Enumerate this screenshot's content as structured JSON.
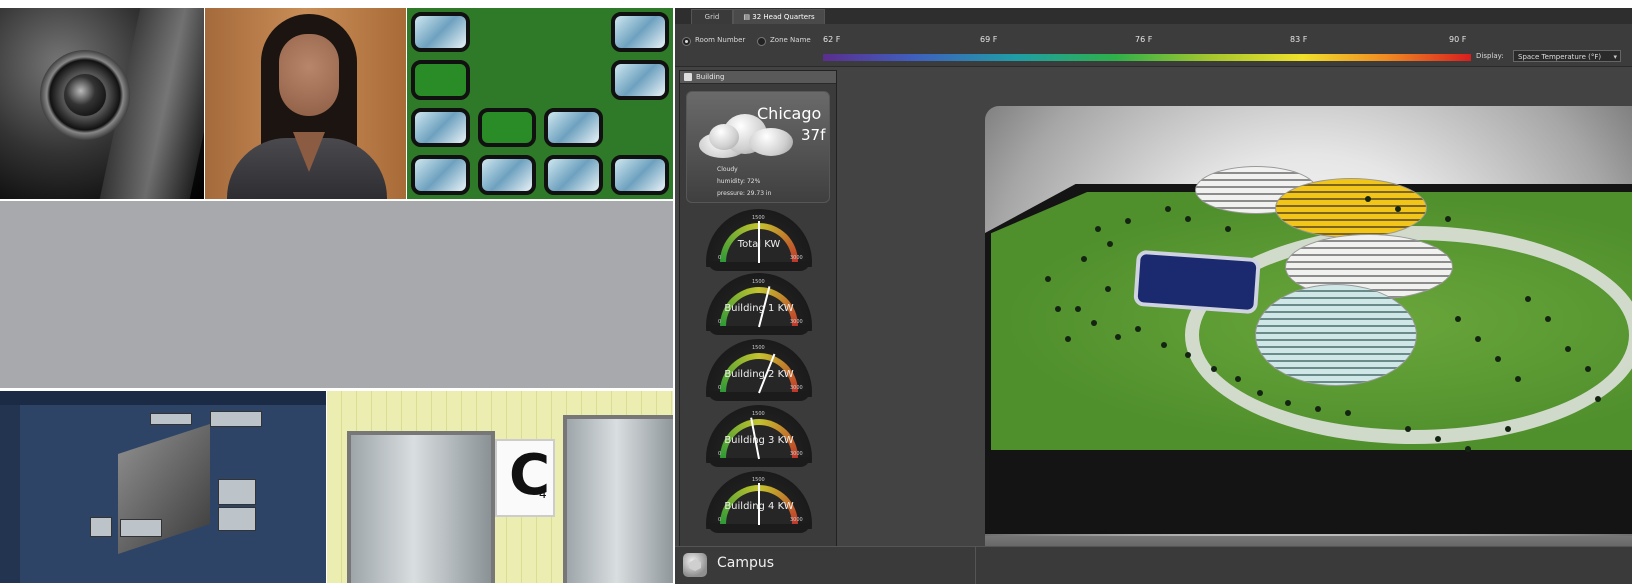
{
  "app": {
    "tabs": [
      {
        "label": "Grid"
      },
      {
        "label": "32 Head Quarters"
      }
    ],
    "toolbar": {
      "room_number_label": "Room Number",
      "zone_name_label": "Zone Name",
      "temp_ticks": [
        "62 F",
        "69 F",
        "76 F",
        "83 F",
        "90 F"
      ],
      "display_label": "Display:",
      "display_value": "Space Temperature (°F)"
    },
    "panel": {
      "title": "Building"
    },
    "weather": {
      "city": "Chicago",
      "temperature": "37f",
      "condition": "Cloudy",
      "humidity": "humidity: 72%",
      "pressure": "pressure: 29.73 in"
    },
    "gauges": [
      {
        "label": "Total KW",
        "min": "0",
        "mid": "1500",
        "max": "3000",
        "value_fraction": 0.5
      },
      {
        "label": "Building 1 KW",
        "min": "0",
        "mid": "1500",
        "max": "3000",
        "value_fraction": 0.58
      },
      {
        "label": "Building 2 KW",
        "min": "0",
        "mid": "1500",
        "max": "3000",
        "value_fraction": 0.62
      },
      {
        "label": "Building 3 KW",
        "min": "0",
        "mid": "1500",
        "max": "3000",
        "value_fraction": 0.44
      },
      {
        "label": "Building 4 KW",
        "min": "0",
        "mid": "1500",
        "max": "3000",
        "value_fraction": 0.5
      }
    ],
    "footer": {
      "label": "Campus"
    }
  },
  "collage": {
    "elevator_sign": "C",
    "elevator_sign_sub": "4"
  }
}
